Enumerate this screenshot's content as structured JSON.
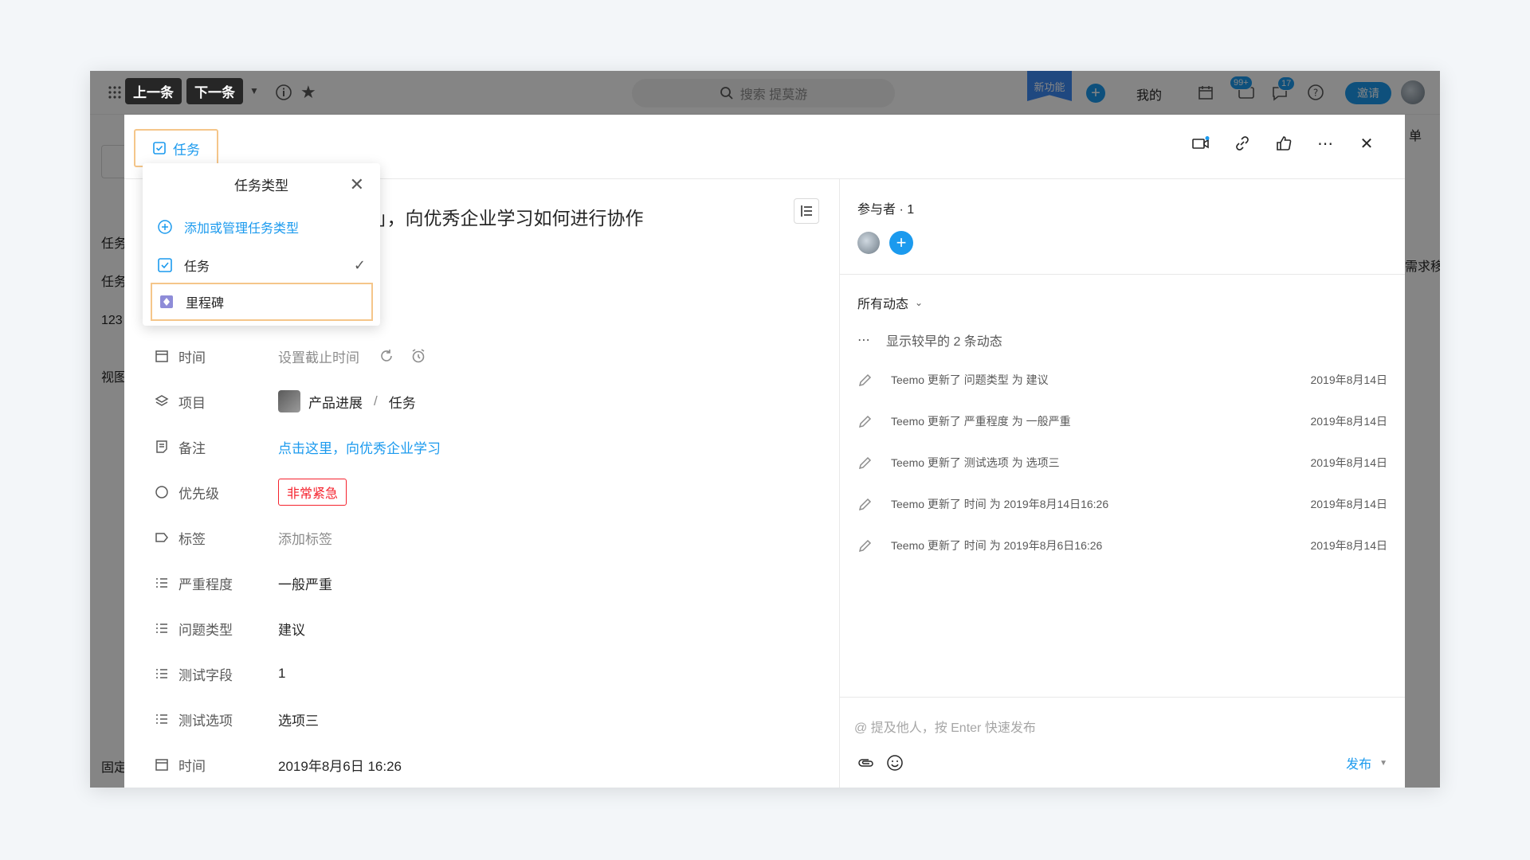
{
  "topbar": {
    "prev_label": "上一条",
    "next_label": "下一条",
    "search_placeholder": "搜索 提莫游",
    "new_feature": "新功能",
    "mine": "我的",
    "badge_notifications": "99+",
    "badge_messages": "17",
    "invite": "邀请"
  },
  "background": {
    "right_header": "单",
    "right_row": "需求移动",
    "side_items": [
      "任务",
      "任务",
      "123",
      "视图",
      "固定"
    ]
  },
  "modal": {
    "type_button": "任务",
    "title": "」，向优秀企业学习如何进行协作",
    "fields": [
      {
        "label": "时间",
        "value": "设置截止时间"
      },
      {
        "label": "项目",
        "value": "产品进展",
        "sub": "任务",
        "sep": "/"
      },
      {
        "label": "备注",
        "value": "点击这里，向优秀企业学习"
      },
      {
        "label": "优先级",
        "value": "非常紧急"
      },
      {
        "label": "标签",
        "value": "添加标签"
      },
      {
        "label": "严重程度",
        "value": "一般严重"
      },
      {
        "label": "问题类型",
        "value": "建议"
      },
      {
        "label": "测试字段",
        "value": "1"
      },
      {
        "label": "测试选项",
        "value": "选项三"
      },
      {
        "label": "时间",
        "value": "2019年8月6日 16:26"
      }
    ]
  },
  "popover": {
    "title": "任务类型",
    "add_manage": "添加或管理任务类型",
    "items": [
      {
        "label": "任务",
        "selected": true
      },
      {
        "label": "里程碑",
        "selected": false
      }
    ]
  },
  "right": {
    "participants": "参与者 · 1",
    "activity_filter": "所有动态",
    "show_earlier": "显示较早的 2 条动态",
    "activities": [
      {
        "text": "Teemo 更新了 问题类型 为 建议",
        "date": "2019年8月14日"
      },
      {
        "text": "Teemo 更新了 严重程度 为 一般严重",
        "date": "2019年8月14日"
      },
      {
        "text": "Teemo 更新了 测试选项 为 选项三",
        "date": "2019年8月14日"
      },
      {
        "text": "Teemo 更新了 时间 为 2019年8月14日16:26",
        "date": "2019年8月14日"
      },
      {
        "text": "Teemo 更新了 时间 为 2019年8月6日16:26",
        "date": "2019年8月14日"
      }
    ],
    "comment_placeholder": "@ 提及他人，按 Enter 快速发布",
    "publish": "发布"
  },
  "colors": {
    "accent": "#1b9aee",
    "highlight": "#f5c68a",
    "danger": "#f5222d"
  }
}
